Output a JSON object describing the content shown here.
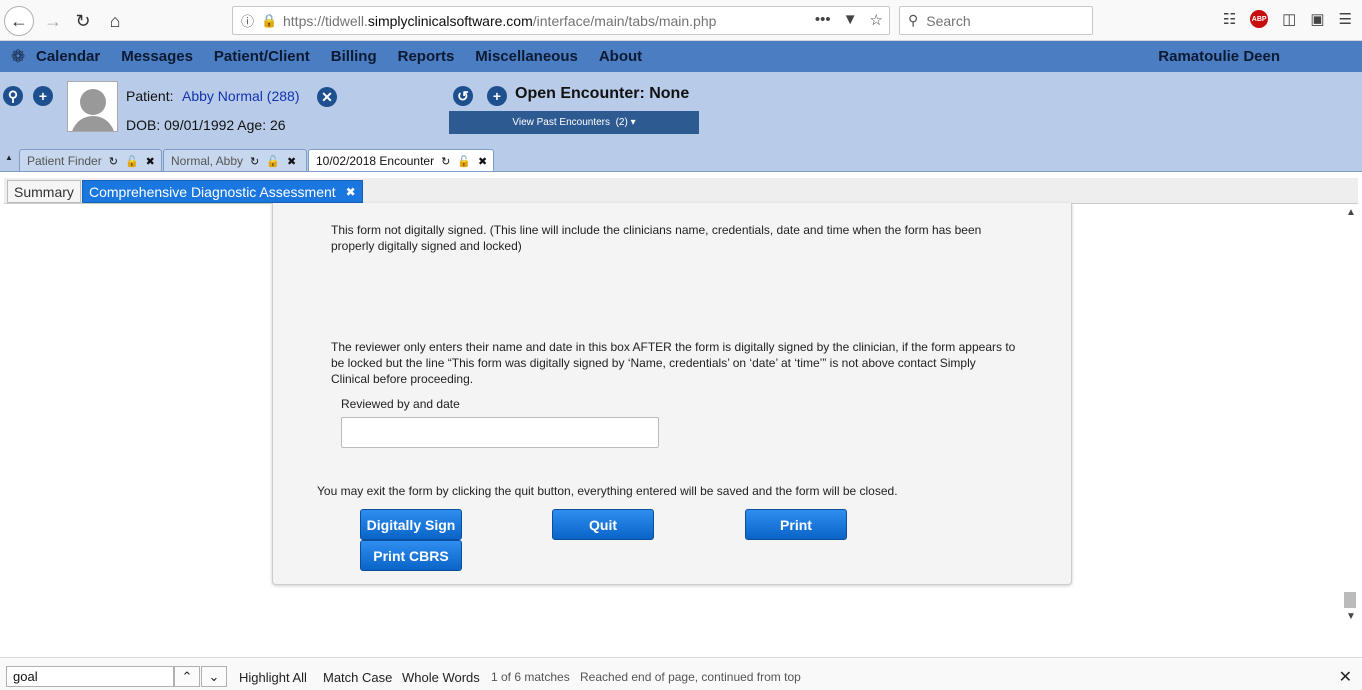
{
  "browser": {
    "url_prefix": "https://tidwell.",
    "url_domain": "simplyclinicalsoftware.com",
    "url_path": "/interface/main/tabs/main.php",
    "search_placeholder": "Search",
    "abp_label": "ABP"
  },
  "menu": {
    "items": [
      "Calendar",
      "Messages",
      "Patient/Client",
      "Billing",
      "Reports",
      "Miscellaneous",
      "About"
    ],
    "user": "Ramatoulie Deen"
  },
  "patient": {
    "label": "Patient:",
    "name": "Abby Normal (288)",
    "dob": "DOB: 09/01/1992 Age: 26",
    "encounter": "Open Encounter: None",
    "past_encounters": "View Past Encounters",
    "past_count": "(2)"
  },
  "tabs": [
    {
      "label": "Patient Finder"
    },
    {
      "label": "Normal, Abby"
    },
    {
      "label": "10/02/2018 Encounter"
    }
  ],
  "subtabs": {
    "summary": "Summary",
    "cda": "Comprehensive Diagnostic Assessment"
  },
  "form": {
    "signature_note": "This form not digitally signed. (This line will include the clinicians name, credentials, date and time when the form has been properly digitally signed and locked)",
    "reviewer_note": "The reviewer only enters their name and date in this box AFTER the form is digitally signed by the clinician, if the form appears to be locked but the line “This form was digitally signed by ‘Name, credentials’ on ‘date’ at ‘time’” is not above contact Simply Clinical before proceeding.",
    "reviewed_label": "Reviewed by and date",
    "reviewed_value": "",
    "exit_note": "You may exit the form by clicking the quit button, everything entered will be saved and the form will be closed.",
    "buttons": {
      "sign": "Digitally Sign",
      "quit": "Quit",
      "print": "Print",
      "print_cbrs": "Print CBRS"
    }
  },
  "find": {
    "query": "goal",
    "highlight_all": "Highlight All",
    "match_case": "Match Case",
    "whole_words": "Whole Words",
    "match_count": "1 of 6 matches",
    "status": "Reached end of page, continued from top"
  }
}
